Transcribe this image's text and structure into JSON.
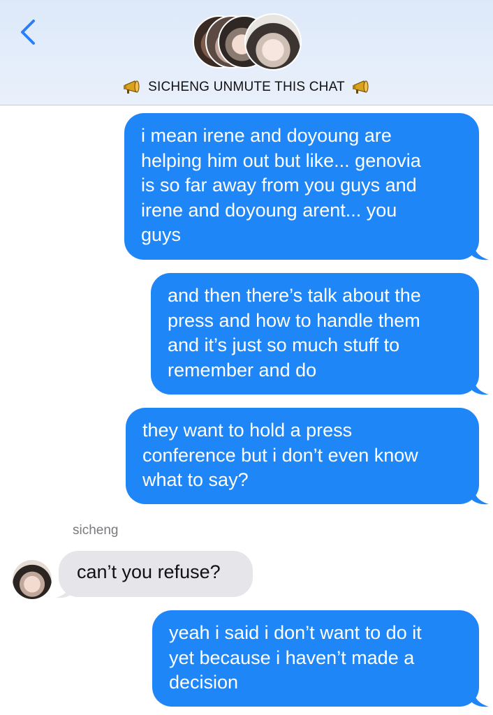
{
  "header": {
    "back_icon": "chevron-left-icon",
    "accent_color": "#2a7ff7",
    "title": "SICHENG UNMUTE THIS CHAT",
    "title_icon": "megaphone-icon"
  },
  "messages": [
    {
      "direction": "outgoing",
      "lines": [
        "i mean irene and doyoung are",
        "helping him out but like... genovia",
        "is so far away from you guys and",
        "irene and doyoung arent... you",
        "guys"
      ]
    },
    {
      "direction": "outgoing",
      "lines": [
        "and then there’s talk about the",
        "press and how to handle them",
        "and it’s just so much stuff to",
        "remember and do"
      ]
    },
    {
      "direction": "outgoing",
      "lines": [
        "they want to hold a press",
        "conference but i don’t even know",
        "what to say?"
      ]
    },
    {
      "direction": "incoming",
      "sender": "sicheng",
      "lines": [
        "can’t you refuse?"
      ]
    },
    {
      "direction": "outgoing",
      "lines": [
        "yeah i said i don’t want to do it",
        "yet because i haven’t made a",
        "decision"
      ]
    }
  ],
  "colors": {
    "outgoing_bubble": "#1f86f8",
    "incoming_bubble": "#e5e5ea"
  }
}
